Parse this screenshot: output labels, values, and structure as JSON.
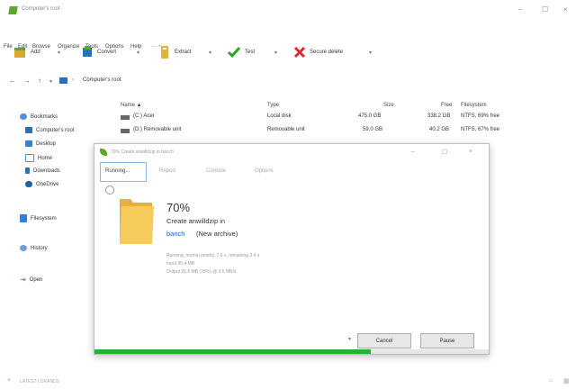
{
  "window": {
    "title": "Computer's root",
    "controls": [
      "–",
      "☐",
      "×"
    ]
  },
  "menu": [
    "File",
    "Edit",
    "Browse",
    "Organize",
    "Tools",
    "Options",
    "Help"
  ],
  "toolbar": {
    "add": "Add",
    "convert": "Convert",
    "extract": "Extract",
    "test": "Test",
    "secure_delete": "Secure delete"
  },
  "address": {
    "path": "Computer's root"
  },
  "sidebar": {
    "items": [
      "Bookmarks",
      "Computer's root",
      "Desktop",
      "Home",
      "Downloads",
      "OneDrive",
      "Filesystem",
      "History",
      "Open"
    ]
  },
  "list": {
    "headers": {
      "name": "Name ▲",
      "type": "Type",
      "size": "Size",
      "free": "Free",
      "fs": "Filesystem"
    },
    "rows": [
      {
        "name": "(C:) Acer",
        "type": "Local disk",
        "size": "475.0 GB",
        "free": "338.2 GB",
        "fs": "NTFS, 69% free"
      },
      {
        "name": "(D:) Removable unit",
        "type": "Removable unit",
        "size": "59.0 GB",
        "free": "40.2 GB",
        "fs": "NTFS, 67% free"
      }
    ]
  },
  "dialog": {
    "title": "70% Create anwilldzip in banch",
    "tabs": [
      "Running...",
      "Report",
      "Console",
      "Options"
    ],
    "percent": "70%",
    "operation": "Create anwilldzip in",
    "archive_link": "banch",
    "archive_note": "(New archive)",
    "stats": [
      "Running, normal priority, 7.6 s, remaining 3.4 s",
      "Input 95.4 MB",
      "Output 26.6 MB (28%) @ 3.5 MB/s"
    ],
    "buttons": {
      "cancel": "Cancel",
      "pause": "Pause"
    },
    "progress": 0.7
  },
  "statusbar": {
    "text": "LATEST LORANDS"
  },
  "colors": {
    "accent_green": "#26b03a",
    "link_blue": "#1f5fb0",
    "folder_yellow": "#f2c14e"
  }
}
